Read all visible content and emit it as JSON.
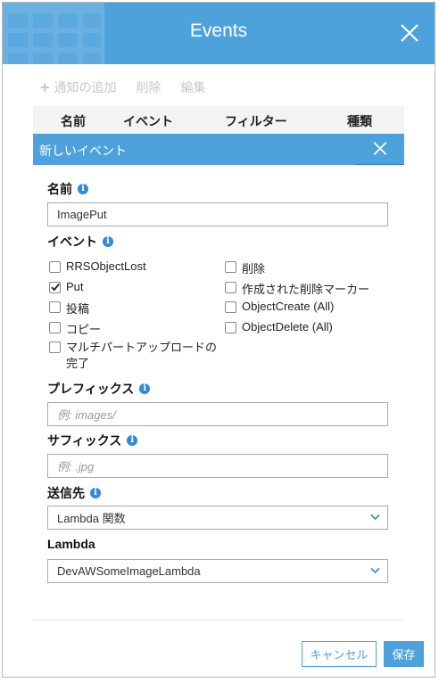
{
  "dialog": {
    "title": "Events"
  },
  "toolbar": {
    "add_label": "通知の追加",
    "delete_label": "削除",
    "edit_label": "編集"
  },
  "table": {
    "columns": [
      "名前",
      "イベント",
      "フィルター",
      "種類"
    ]
  },
  "panel": {
    "title": "新しいイベント"
  },
  "form": {
    "name": {
      "label": "名前",
      "value": "ImagePut"
    },
    "events": {
      "label": "イベント",
      "options": [
        {
          "label": "RRSObjectLost",
          "checked": false
        },
        {
          "label": "削除",
          "checked": false
        },
        {
          "label": "Put",
          "checked": true
        },
        {
          "label": "作成された削除マーカー",
          "checked": false
        },
        {
          "label": "投稿",
          "checked": false
        },
        {
          "label": "ObjectCreate (All)",
          "checked": false
        },
        {
          "label": "コピー",
          "checked": false
        },
        {
          "label": "ObjectDelete (All)",
          "checked": false
        },
        {
          "label": "マルチパートアップロードの完了",
          "checked": false
        }
      ]
    },
    "prefix": {
      "label": "プレフィックス",
      "placeholder": "例: images/"
    },
    "suffix": {
      "label": "サフィックス",
      "placeholder": "例: .jpg"
    },
    "destination": {
      "label": "送信先",
      "value": "Lambda 関数"
    },
    "lambda": {
      "label": "Lambda",
      "value": "DevAWSomeImageLambda"
    }
  },
  "footer": {
    "cancel_label": "キャンセル",
    "save_label": "保存"
  },
  "colors": {
    "accent": "#4ea2dc",
    "info": "#2f8ad8"
  }
}
